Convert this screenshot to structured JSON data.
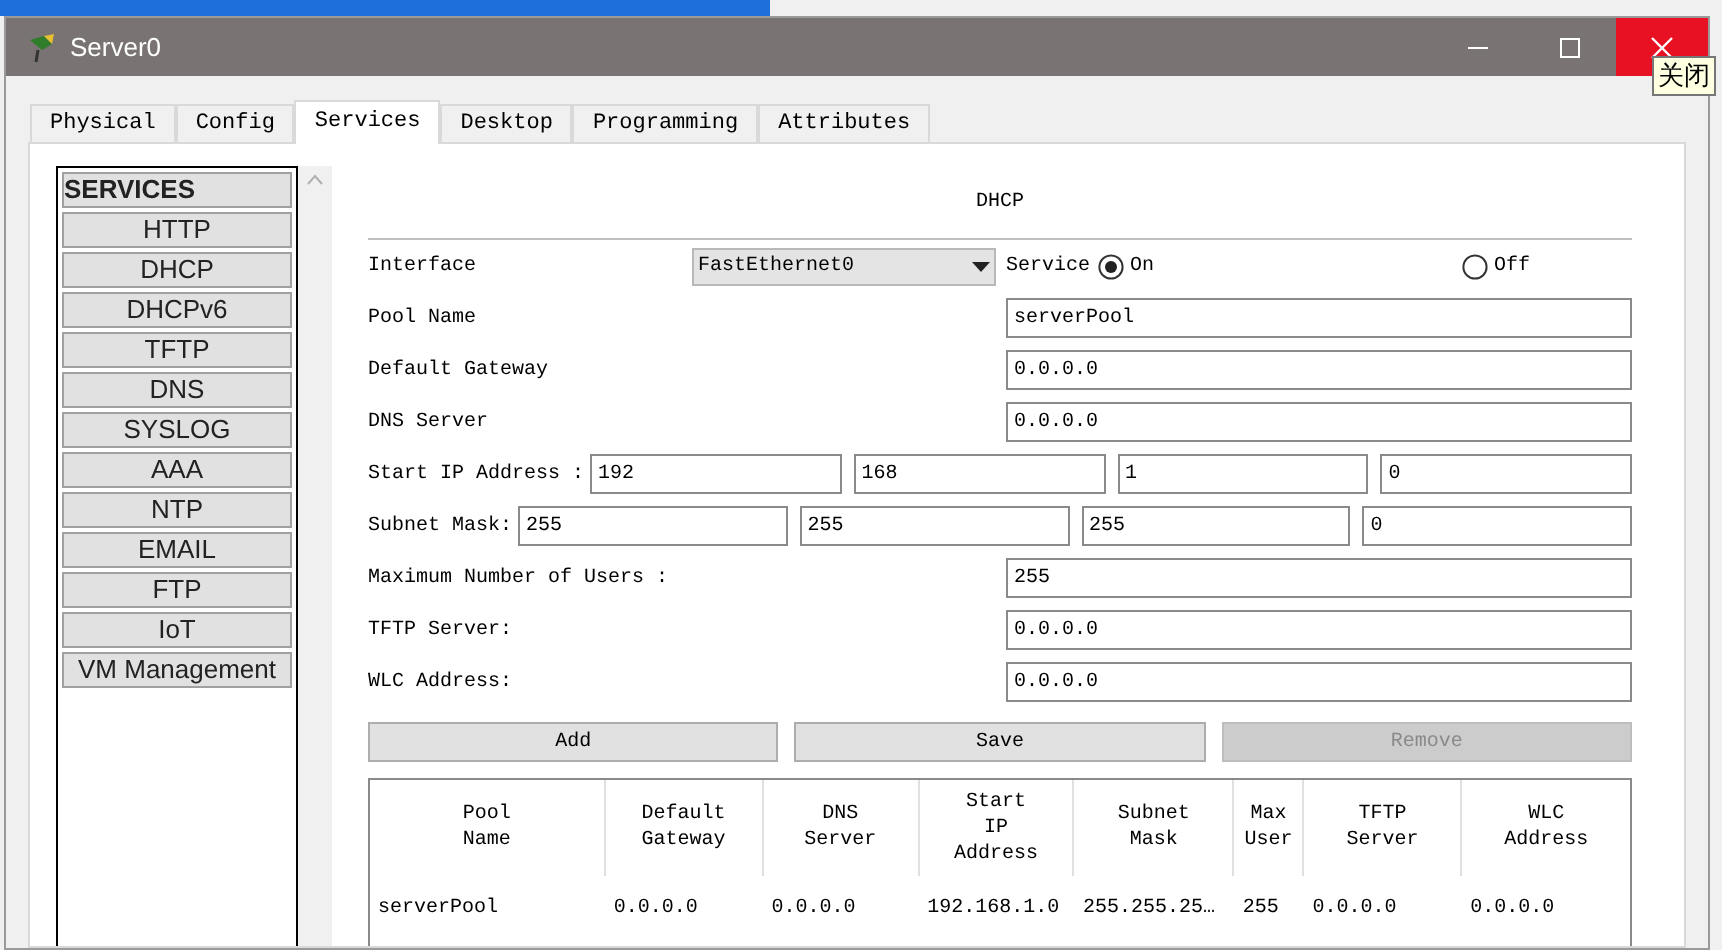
{
  "window": {
    "title": "Server0",
    "tooltip": "关闭"
  },
  "tabs": [
    {
      "label": "Physical",
      "selected": false
    },
    {
      "label": "Config",
      "selected": false
    },
    {
      "label": "Services",
      "selected": true
    },
    {
      "label": "Desktop",
      "selected": false
    },
    {
      "label": "Programming",
      "selected": false
    },
    {
      "label": "Attributes",
      "selected": false
    }
  ],
  "services": [
    {
      "label": "SERVICES",
      "kind": "header"
    },
    {
      "label": "HTTP",
      "kind": "item"
    },
    {
      "label": "DHCP",
      "kind": "item"
    },
    {
      "label": "DHCPv6",
      "kind": "item"
    },
    {
      "label": "TFTP",
      "kind": "item"
    },
    {
      "label": "DNS",
      "kind": "item"
    },
    {
      "label": "SYSLOG",
      "kind": "item"
    },
    {
      "label": "AAA",
      "kind": "item"
    },
    {
      "label": "NTP",
      "kind": "item"
    },
    {
      "label": "EMAIL",
      "kind": "item"
    },
    {
      "label": "FTP",
      "kind": "item"
    },
    {
      "label": "IoT",
      "kind": "item"
    },
    {
      "label": "VM Management",
      "kind": "item"
    }
  ],
  "panel": {
    "title": "DHCP",
    "interface": {
      "label": "Interface",
      "value": "FastEthernet0"
    },
    "service": {
      "label": "Service",
      "options": [
        {
          "label": "On",
          "selected": true
        },
        {
          "label": "Off",
          "selected": false
        }
      ]
    },
    "fields": [
      {
        "kind": "single",
        "label": "Pool Name",
        "values": [
          "serverPool"
        ]
      },
      {
        "kind": "single",
        "label": "Default Gateway",
        "values": [
          "0.0.0.0"
        ]
      },
      {
        "kind": "single",
        "label": "DNS Server",
        "values": [
          "0.0.0.0"
        ]
      },
      {
        "kind": "quad",
        "label": "Start IP Address :",
        "values": [
          "192",
          "168",
          "1",
          "0"
        ]
      },
      {
        "kind": "quad",
        "label": "Subnet Mask:",
        "values": [
          "255",
          "255",
          "255",
          "0"
        ]
      },
      {
        "kind": "single",
        "label": "Maximum Number of Users :",
        "values": [
          "255"
        ]
      },
      {
        "kind": "single",
        "label": "TFTP Server:",
        "values": [
          "0.0.0.0"
        ]
      },
      {
        "kind": "single",
        "label": "WLC Address:",
        "values": [
          "0.0.0.0"
        ]
      }
    ],
    "buttons": [
      {
        "label": "Add",
        "disabled": false
      },
      {
        "label": "Save",
        "disabled": false
      },
      {
        "label": "Remove",
        "disabled": true
      }
    ],
    "table": {
      "columns": [
        "Pool\nName",
        "Default\nGateway",
        "DNS\nServer",
        "Start\nIP\nAddress",
        "Subnet\nMask",
        "Max\nUser",
        "TFTP\nServer",
        "WLC\nAddress"
      ],
      "rows": [
        [
          "serverPool",
          "0.0.0.0",
          "0.0.0.0",
          "192.168.1.0",
          "255.255.25…",
          "255",
          "0.0.0.0",
          "0.0.0.0"
        ]
      ]
    }
  }
}
